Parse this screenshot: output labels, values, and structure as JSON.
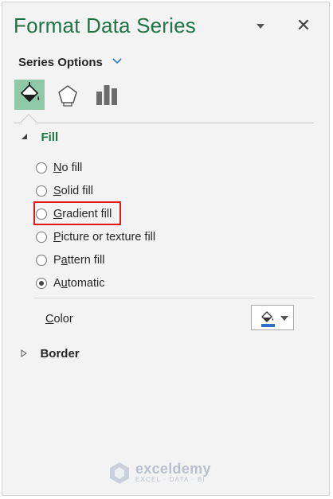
{
  "pane": {
    "title": "Format Data Series",
    "title_color": "#217346",
    "options_dropdown_icon": "chevron-down-icon",
    "close_label": "✕"
  },
  "series_options": {
    "label": "Series Options",
    "icon": "chevron-down-icon"
  },
  "tabs": [
    {
      "name": "fill-line",
      "icon": "paint-bucket-icon",
      "active": true
    },
    {
      "name": "effects",
      "icon": "pentagon-icon",
      "active": false
    },
    {
      "name": "series-options",
      "icon": "bar-chart-icon",
      "active": false
    }
  ],
  "fill": {
    "section_label": "Fill",
    "expanded": true,
    "options": [
      {
        "label": "No fill",
        "mnemonic": "N",
        "rest": "o fill",
        "checked": false
      },
      {
        "label": "Solid fill",
        "mnemonic": "S",
        "rest": "olid fill",
        "checked": false
      },
      {
        "label": "Gradient fill",
        "mnemonic": "G",
        "rest": "radient fill",
        "checked": false,
        "highlighted": true
      },
      {
        "label": "Picture or texture fill",
        "mnemonic": "P",
        "rest": "icture or texture fill",
        "checked": false
      },
      {
        "label": "Pattern fill",
        "mnemonic": "A",
        "pre": "P",
        "rest": "ttern fill",
        "checked": false
      },
      {
        "label": "Automatic",
        "mnemonic": "U",
        "pre": "A",
        "rest": "tomatic",
        "checked": true
      }
    ],
    "color_label": "Color",
    "color_mnemonic": "C",
    "color_rest": "olor",
    "color_value": "#2f6fc3",
    "highlight_color": "#e3171c"
  },
  "border": {
    "section_label": "Border",
    "expanded": false
  },
  "watermark": {
    "name": "exceldemy",
    "tagline": "EXCEL · DATA · BI"
  }
}
